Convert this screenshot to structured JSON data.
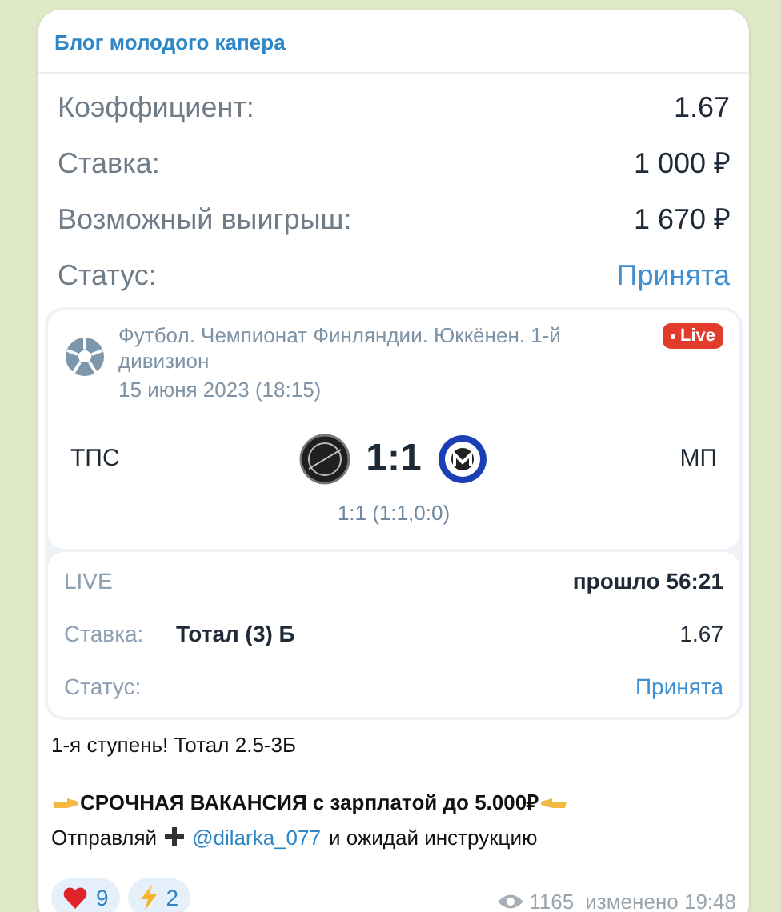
{
  "channel": "Блог молодого капера",
  "summary": [
    {
      "label": "Коэффициент:",
      "value": "1.67",
      "kind": "plain"
    },
    {
      "label": "Ставка:",
      "value": "1 000 ₽",
      "kind": "plain"
    },
    {
      "label": "Возможный выигрыш:",
      "value": "1 670 ₽",
      "kind": "plain"
    },
    {
      "label": "Статус:",
      "value": "Принята",
      "kind": "status"
    }
  ],
  "match": {
    "league": "Футбол. Чемпионат Финляндии. Юккёнен. 1-й дивизион",
    "date": "15 июня 2023 (18:15)",
    "badge": "Live",
    "home": "ТПС",
    "score": "1:1",
    "away": "МП",
    "detail": "1:1 (1:1,0:0)"
  },
  "bet": {
    "live_label": "LIVE",
    "elapsed": "прошло 56:21",
    "stake_label": "Ставка:",
    "stake": "Тотал (3) Б",
    "odds": "1.67",
    "status_label": "Статус:",
    "status": "Принята"
  },
  "message": {
    "line1": "1-я ступень! Тотал 2.5-3Б",
    "headline": "СРОЧНАЯ ВАКАНСИЯ с зарплатой до 5.000₽",
    "send": "Отправляй",
    "mention": "@dilarka_077",
    "rest": "и ожидай инструкцию"
  },
  "reactions": [
    {
      "kind": "heart",
      "count": "9"
    },
    {
      "kind": "lightning",
      "count": "2"
    }
  ],
  "views": "1165",
  "edited": "изменено 19:48"
}
